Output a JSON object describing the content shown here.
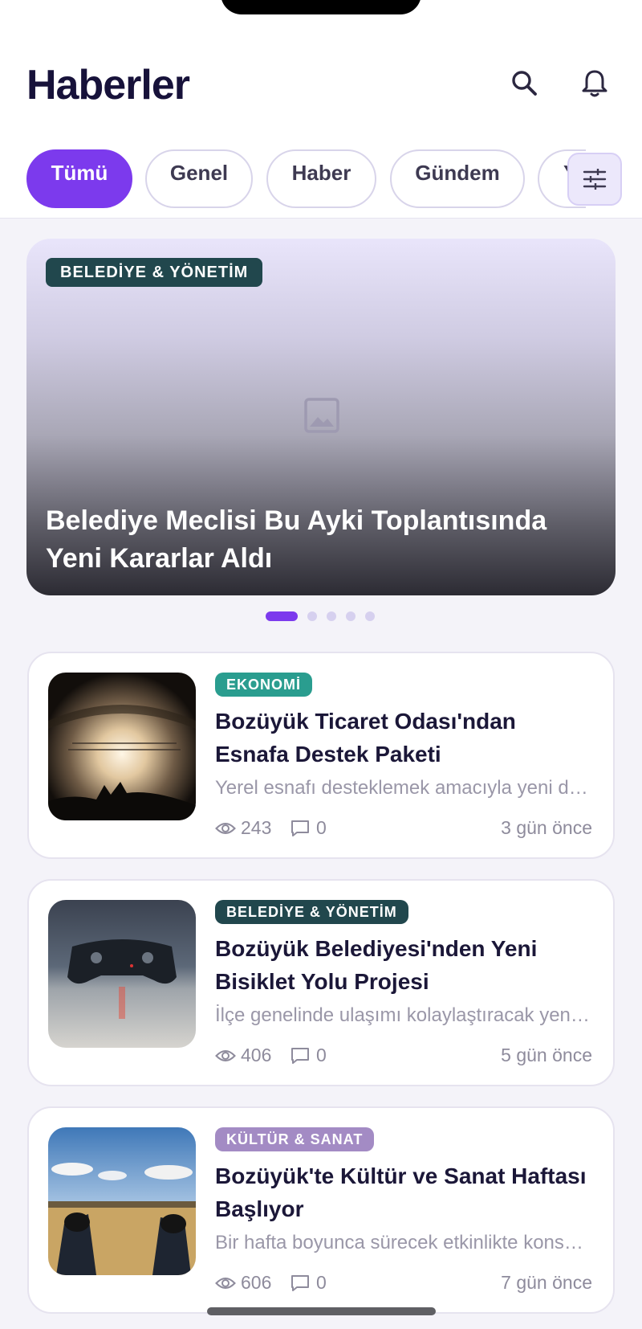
{
  "header": {
    "title": "Haberler",
    "search_icon": "search-icon",
    "bell_icon": "bell-icon"
  },
  "categories": {
    "items": [
      {
        "label": "Tümü",
        "active": true
      },
      {
        "label": "Genel",
        "active": false
      },
      {
        "label": "Haber",
        "active": false
      },
      {
        "label": "Gündem",
        "active": false
      },
      {
        "label": "Y",
        "active": false
      }
    ],
    "filter_icon": "sliders-icon"
  },
  "featured": {
    "tag": "BELEDİYE & YÖNETİM",
    "title": "Belediye Meclisi Bu Ayki Toplantısında Yeni Kararlar Aldı",
    "image_icon": "image-placeholder-icon",
    "pager": {
      "count": 5,
      "active_index": 0
    }
  },
  "news": [
    {
      "tag": "EKONOMİ",
      "tag_color": "#2a9d8f",
      "title": "Bozüyük Ticaret Odası'ndan Esnafa Destek Paketi",
      "description": "Yerel esnafı desteklemek amacıyla yeni destek paketi açıklandı",
      "views": "243",
      "comments": "0",
      "time": "3 gün önce",
      "thumb": "concert-photo"
    },
    {
      "tag": "BELEDİYE & YÖNETİM",
      "tag_color": "#21474d",
      "title": "Bozüyük Belediyesi'nden Yeni Bisiklet Yolu Projesi",
      "description": "İlçe genelinde ulaşımı kolaylaştıracak yeni bisiklet yolu",
      "views": "406",
      "comments": "0",
      "time": "5 gün önce",
      "thumb": "gamepad-photo"
    },
    {
      "tag": "KÜLTÜR & SANAT",
      "tag_color": "#a38bc4",
      "title": "Bozüyük'te Kültür ve Sanat Haftası Başlıyor",
      "description": "Bir hafta boyunca sürecek etkinlikte konserler ve sergiler",
      "views": "606",
      "comments": "0",
      "time": "7 gün önce",
      "thumb": "field-photo"
    }
  ]
}
